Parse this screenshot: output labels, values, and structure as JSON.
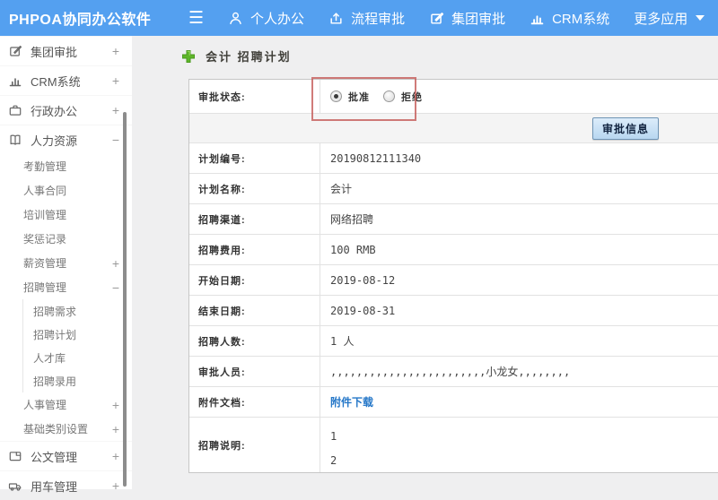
{
  "topbar": {
    "brand": "PHPOA协同办公软件",
    "nav": [
      {
        "label": "个人办公",
        "icon": "user-icon"
      },
      {
        "label": "流程审批",
        "icon": "process-icon"
      },
      {
        "label": "集团审批",
        "icon": "edit-icon"
      },
      {
        "label": "CRM系统",
        "icon": "bar-chart-icon"
      },
      {
        "label": "更多应用",
        "icon": "caret-down-icon"
      }
    ]
  },
  "sidebar": {
    "items": [
      {
        "label": "集团审批",
        "expand": "+",
        "level": 1,
        "icon": "edit-square-icon"
      },
      {
        "label": "CRM系统",
        "expand": "+",
        "level": 1,
        "icon": "bar-chart-icon"
      },
      {
        "label": "行政办公",
        "expand": "+",
        "level": 1,
        "icon": "briefcase-icon"
      },
      {
        "label": "人力资源",
        "expand": "−",
        "level": 1,
        "icon": "book-icon"
      },
      {
        "label": "考勤管理",
        "level": 2
      },
      {
        "label": "人事合同",
        "level": 2
      },
      {
        "label": "培训管理",
        "level": 2
      },
      {
        "label": "奖惩记录",
        "level": 2
      },
      {
        "label": "薪资管理",
        "expand": "+",
        "level": 2
      },
      {
        "label": "招聘管理",
        "expand": "−",
        "level": 2
      },
      {
        "label": "招聘需求",
        "level": 3
      },
      {
        "label": "招聘计划",
        "level": 3
      },
      {
        "label": "人才库",
        "level": 3
      },
      {
        "label": "招聘录用",
        "level": 3
      },
      {
        "label": "人事管理",
        "expand": "+",
        "level": 2
      },
      {
        "label": "基础类别设置",
        "expand": "+",
        "level": 2
      },
      {
        "label": "公文管理",
        "expand": "+",
        "level": 1,
        "icon": "document-icon"
      },
      {
        "label": "用车管理",
        "expand": "+",
        "level": 1,
        "icon": "car-icon"
      }
    ]
  },
  "main": {
    "title": "会计 招聘计划",
    "approval": {
      "label": "审批状态:",
      "options": [
        {
          "label": "批准",
          "checked": true
        },
        {
          "label": "拒绝",
          "checked": false
        }
      ],
      "button": "审批信息"
    },
    "fields": [
      {
        "label": "计划编号:",
        "value": "20190812111340"
      },
      {
        "label": "计划名称:",
        "value": "会计"
      },
      {
        "label": "招聘渠道:",
        "value": "网络招聘"
      },
      {
        "label": "招聘费用:",
        "value": "100 RMB"
      },
      {
        "label": "开始日期:",
        "value": "2019-08-12"
      },
      {
        "label": "结束日期:",
        "value": "2019-08-31"
      },
      {
        "label": "招聘人数:",
        "value": "1 人"
      },
      {
        "label": "审批人员:",
        "value": ",,,,,,,,,,,,,,,,,,,,,,,,小龙女,,,,,,,,"
      },
      {
        "label": "附件文档:",
        "value": "附件下载",
        "link": true
      },
      {
        "label": "招聘说明:",
        "value": "1\n2"
      }
    ]
  },
  "colors": {
    "topbar_blue": "#54a0f0",
    "annotation_red": "#c45a58",
    "link_blue": "#2577c8",
    "plus_green": "#5eb629",
    "button_border_blue": "#6f94b4"
  }
}
